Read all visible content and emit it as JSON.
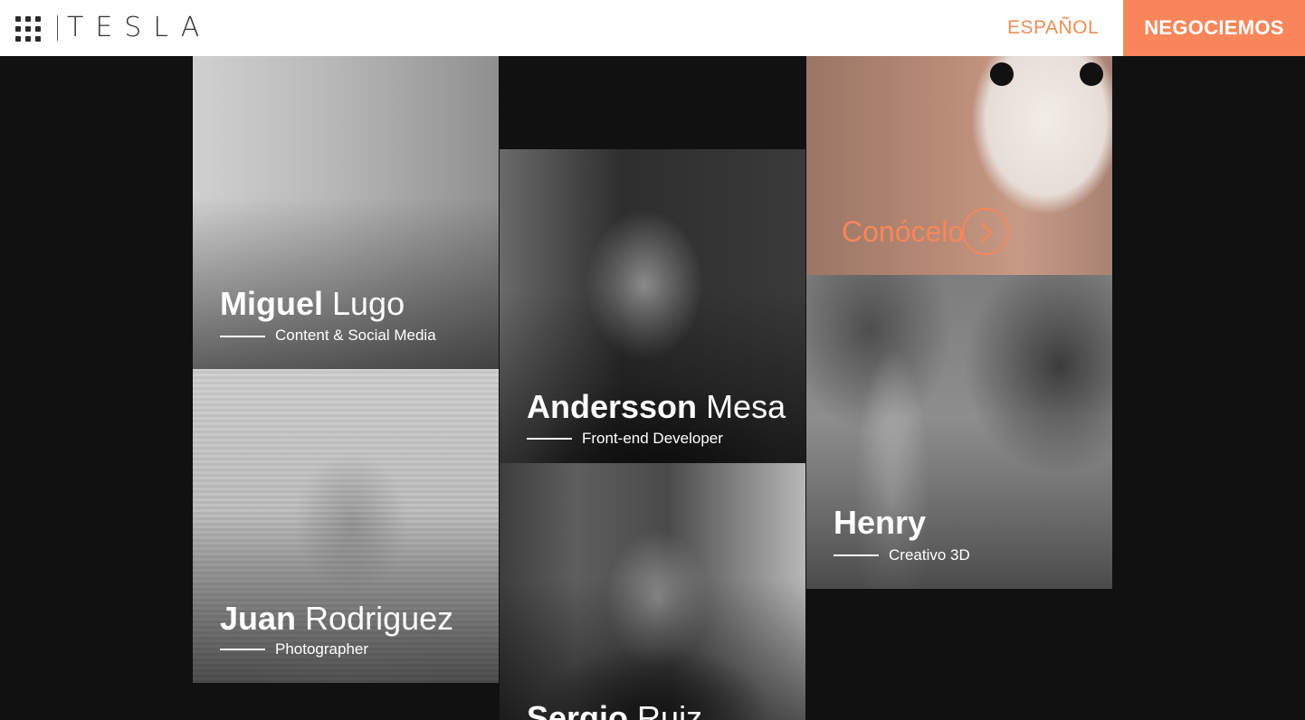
{
  "header": {
    "logo": "TESLA",
    "language": "ESPAÑOL",
    "cta": "NEGOCIEMOS"
  },
  "team": [
    {
      "first": "Miguel",
      "last": "Lugo",
      "role": "Content & Social Media"
    },
    {
      "first": "Juan",
      "last": "Rodriguez",
      "role": "Photographer"
    },
    {
      "first": "Andersson",
      "last": "Mesa",
      "role": "Front-end Developer"
    },
    {
      "first": "Sergio",
      "last": "Ruiz",
      "role": ""
    },
    {
      "first": "Henry",
      "last": "",
      "role": "Creativo 3D"
    }
  ],
  "promo": {
    "label": "Conócelo",
    "icon": "chevron-right-circle-icon"
  },
  "colors": {
    "accent": "#f8865a",
    "background": "#111111"
  }
}
